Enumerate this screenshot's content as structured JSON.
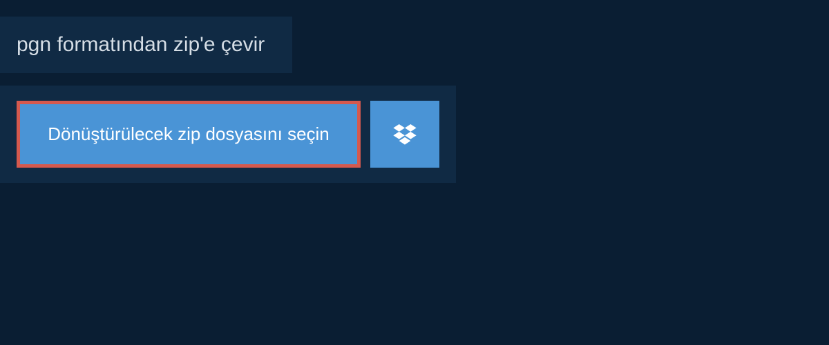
{
  "header": {
    "title": "pgn formatından zip'e çevir"
  },
  "upload": {
    "select_file_label": "Dönüştürülecek zip dosyasını seçin",
    "dropbox_icon_name": "dropbox-icon"
  },
  "colors": {
    "background": "#0a1e33",
    "panel": "#102a44",
    "button": "#4a94d6",
    "highlight_border": "#d5594e",
    "text_light": "#d5dde5",
    "text_white": "#ffffff"
  }
}
